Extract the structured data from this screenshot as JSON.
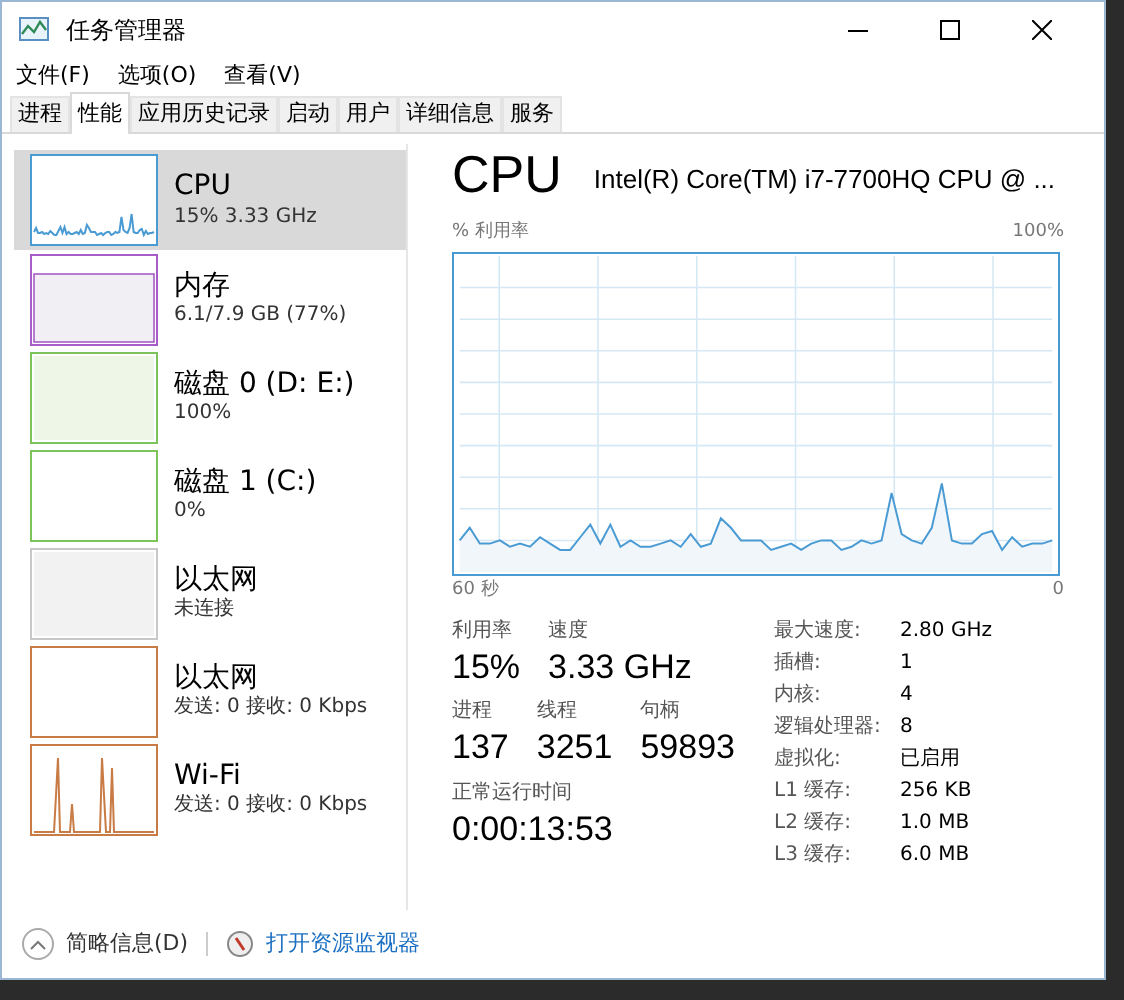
{
  "window": {
    "title": "任务管理器"
  },
  "menu": [
    "文件(F)",
    "选项(O)",
    "查看(V)"
  ],
  "tabs": [
    {
      "label": "进程",
      "selected": false
    },
    {
      "label": "性能",
      "selected": true
    },
    {
      "label": "应用历史记录",
      "selected": false
    },
    {
      "label": "启动",
      "selected": false
    },
    {
      "label": "用户",
      "selected": false
    },
    {
      "label": "详细信息",
      "selected": false
    },
    {
      "label": "服务",
      "selected": false
    }
  ],
  "sidebar": {
    "items": [
      {
        "name": "CPU",
        "detail": "15% 3.33 GHz",
        "selected": true,
        "color": "#4a9bd4",
        "kind": "line"
      },
      {
        "name": "内存",
        "detail": "6.1/7.9 GB (77%)",
        "selected": false,
        "color": "#a85cc8",
        "kind": "fill"
      },
      {
        "name": "磁盘 0 (D: E:)",
        "detail": "100%",
        "selected": false,
        "color": "#7cc35a",
        "kind": "full"
      },
      {
        "name": "磁盘 1 (C:)",
        "detail": "0%",
        "selected": false,
        "color": "#7cc35a",
        "kind": "flat"
      },
      {
        "name": "以太网",
        "detail": "未连接",
        "selected": false,
        "color": "#c8c8c8",
        "kind": "off"
      },
      {
        "name": "以太网",
        "detail": "发送: 0 接收: 0 Kbps",
        "selected": false,
        "color": "#c97b45",
        "kind": "flat"
      },
      {
        "name": "Wi-Fi",
        "detail": "发送: 0 接收: 0 Kbps",
        "selected": false,
        "color": "#c97b45",
        "kind": "spikes"
      }
    ]
  },
  "detail": {
    "title": "CPU",
    "model": "Intel(R) Core(TM) i7-7700HQ CPU @ ...",
    "graph_label": "% 利用率",
    "graph_max": "100%",
    "graph_start": "60 秒",
    "graph_end": "0",
    "stats": [
      {
        "label": "利用率",
        "value": "15%"
      },
      {
        "label": "速度",
        "value": "3.33 GHz"
      }
    ],
    "counts": [
      {
        "label": "进程",
        "value": "137"
      },
      {
        "label": "线程",
        "value": "3251"
      },
      {
        "label": "句柄",
        "value": "59893"
      }
    ],
    "uptime": {
      "label": "正常运行时间",
      "value": "0:00:13:53"
    },
    "specs": [
      {
        "label": "最大速度:",
        "value": "2.80 GHz"
      },
      {
        "label": "插槽:",
        "value": "1"
      },
      {
        "label": "内核:",
        "value": "4"
      },
      {
        "label": "逻辑处理器:",
        "value": "8"
      },
      {
        "label": "虚拟化:",
        "value": "已启用"
      },
      {
        "label": "L1 缓存:",
        "value": "256 KB"
      },
      {
        "label": "L2 缓存:",
        "value": "1.0 MB"
      },
      {
        "label": "L3 缓存:",
        "value": "6.0 MB"
      }
    ]
  },
  "footer": {
    "summary": "简略信息(D)",
    "monitor_link": "打开资源监视器"
  }
}
